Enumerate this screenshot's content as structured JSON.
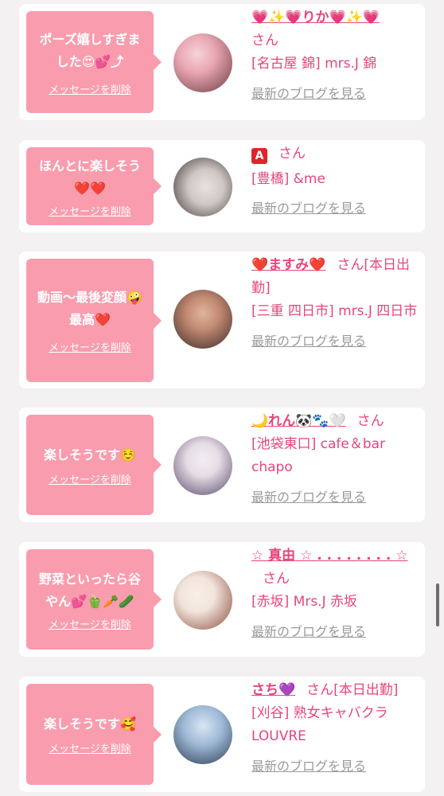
{
  "san_label": "さん",
  "delete_label": "メッセージを削除",
  "blog_label": "最新のブログを見る",
  "items": [
    {
      "message": "ポーズ嬉しすぎま\nした😍💕⤴",
      "name": "💗✨💗りか💗✨💗",
      "suffix": "",
      "shop": "[名古屋 錦] mrs.J 錦",
      "avatar_colors": [
        "#e9a7b4",
        "#6c3b3f"
      ]
    },
    {
      "message": "ほんとに楽しそう\n❤️❤️",
      "name": "🅰",
      "suffix": "",
      "shop": "[豊橋] &me",
      "avatar_colors": [
        "#cfc7c3",
        "#3b3535"
      ]
    },
    {
      "message": "動画〜最後変顔🤪\n最高❤️",
      "name": "❤️ますみ❤️",
      "suffix": "[本日出勤]",
      "shop": "[三重 四日市] mrs.J 四日市",
      "avatar_colors": [
        "#c48b73",
        "#3c2a2a"
      ]
    },
    {
      "message": "楽しそうです☺️",
      "name": "🌙れん🐼🐾🤍",
      "suffix": "",
      "shop": "[池袋東口] cafe＆bar chapo",
      "avatar_colors": [
        "#e6dde6",
        "#5a4a6a"
      ]
    },
    {
      "message": "野菜といったら谷\nやん💕🫑🥕🥒",
      "name": "☆ 真由 ☆ . . . . . . . . ☆",
      "suffix": "",
      "shop": "[赤坂] Mrs.J 赤坂",
      "avatar_colors": [
        "#f2e4dc",
        "#8a4b3a"
      ]
    },
    {
      "message": "楽しそうです🥰",
      "name": "さち💜",
      "suffix": "[本日出勤]",
      "shop": "[刈谷] 熟女キャバクラLOUVRE",
      "avatar_colors": [
        "#9fb9d6",
        "#2d3d55"
      ]
    }
  ]
}
